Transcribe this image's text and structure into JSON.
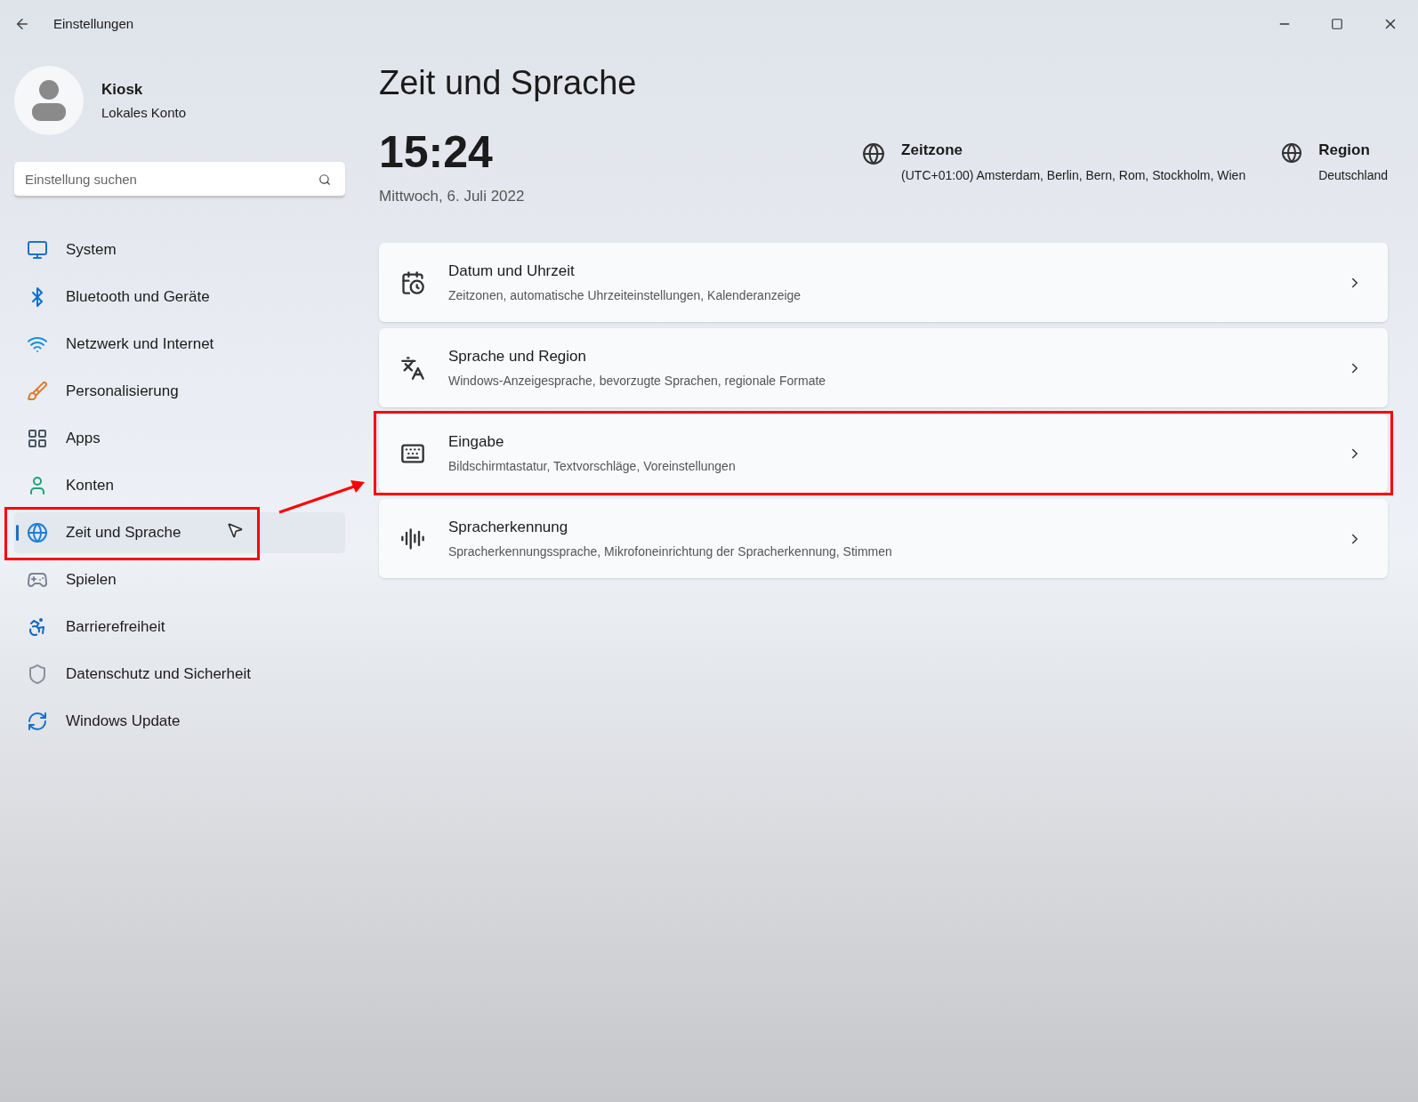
{
  "window": {
    "title": "Einstellungen"
  },
  "account": {
    "name": "Kiosk",
    "type": "Lokales Konto"
  },
  "search": {
    "placeholder": "Einstellung suchen"
  },
  "nav": [
    {
      "label": "System",
      "selected": false,
      "highlighted": false
    },
    {
      "label": "Bluetooth und Geräte",
      "selected": false,
      "highlighted": false
    },
    {
      "label": "Netzwerk und Internet",
      "selected": false,
      "highlighted": false
    },
    {
      "label": "Personalisierung",
      "selected": false,
      "highlighted": false
    },
    {
      "label": "Apps",
      "selected": false,
      "highlighted": false
    },
    {
      "label": "Konten",
      "selected": false,
      "highlighted": false
    },
    {
      "label": "Zeit und Sprache",
      "selected": true,
      "highlighted": true
    },
    {
      "label": "Spielen",
      "selected": false,
      "highlighted": false
    },
    {
      "label": "Barrierefreiheit",
      "selected": false,
      "highlighted": false
    },
    {
      "label": "Datenschutz und Sicherheit",
      "selected": false,
      "highlighted": false
    },
    {
      "label": "Windows Update",
      "selected": false,
      "highlighted": false
    }
  ],
  "page": {
    "title": "Zeit und Sprache"
  },
  "clock": {
    "time": "15:24",
    "date": "Mittwoch, 6. Juli 2022"
  },
  "timezone": {
    "label": "Zeitzone",
    "value": "(UTC+01:00) Amsterdam, Berlin, Bern, Rom, Stockholm, Wien"
  },
  "region": {
    "label": "Region",
    "value": "Deutschland"
  },
  "cards": [
    {
      "title": "Datum und Uhrzeit",
      "subtitle": "Zeitzonen, automatische Uhrzeiteinstellungen, Kalenderanzeige",
      "highlighted": false
    },
    {
      "title": "Sprache und Region",
      "subtitle": "Windows-Anzeigesprache, bevorzugte Sprachen, regionale Formate",
      "highlighted": false
    },
    {
      "title": "Eingabe",
      "subtitle": "Bildschirmtastatur, Textvorschläge, Voreinstellungen",
      "highlighted": true
    },
    {
      "title": "Spracherkennung",
      "subtitle": "Spracherkennungssprache, Mikrofoneinrichtung der Spracherkennung, Stimmen",
      "highlighted": false
    }
  ]
}
